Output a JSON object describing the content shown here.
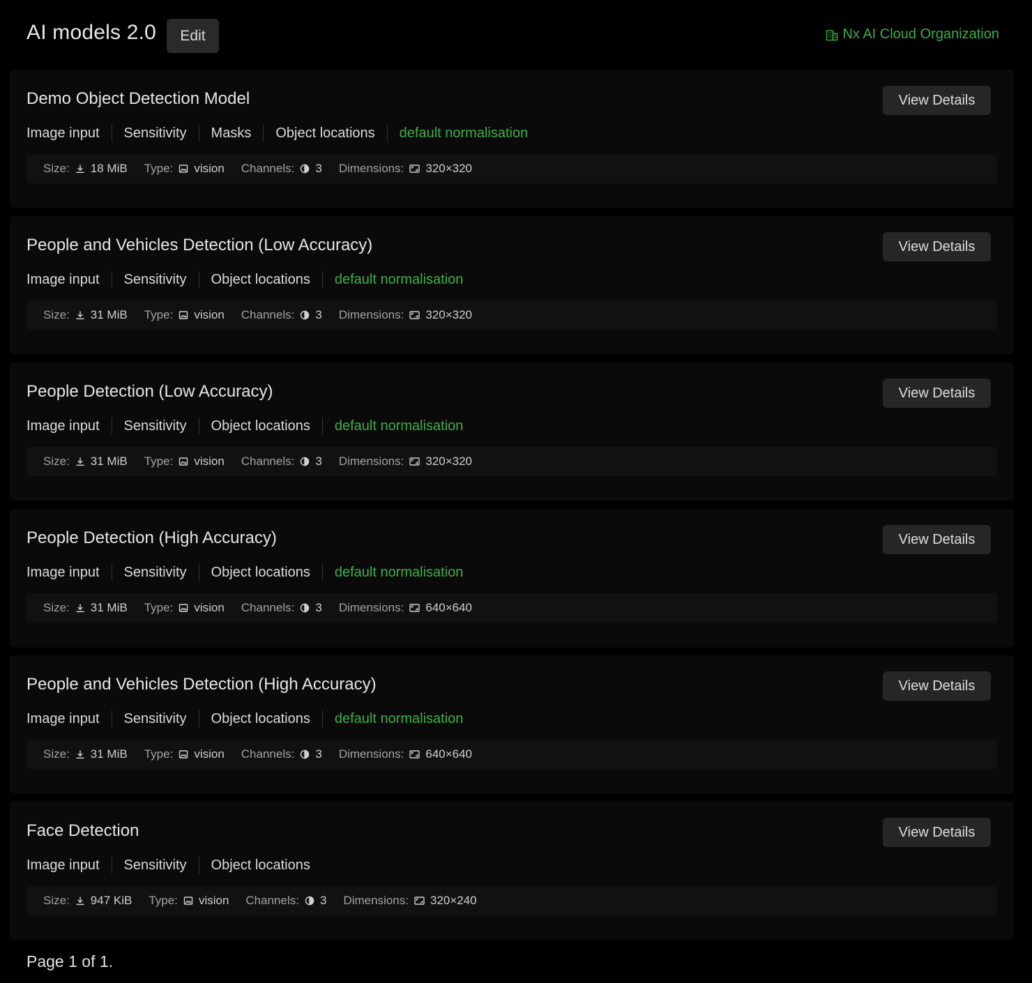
{
  "header": {
    "title": "AI models 2.0",
    "edit_label": "Edit",
    "organization": "Nx AI Cloud Organization"
  },
  "labels": {
    "size": "Size:",
    "type": "Type:",
    "channels": "Channels:",
    "dimensions": "Dimensions:",
    "view_details": "View Details"
  },
  "models": [
    {
      "name": "Demo Object Detection Model",
      "tags": [
        "Image input",
        "Sensitivity",
        "Masks",
        "Object locations"
      ],
      "normalisation": "default normalisation",
      "size": "18 MiB",
      "type": "vision",
      "channels": "3",
      "dimensions": "320×320"
    },
    {
      "name": "People and Vehicles Detection (Low Accuracy)",
      "tags": [
        "Image input",
        "Sensitivity",
        "Object locations"
      ],
      "normalisation": "default normalisation",
      "size": "31 MiB",
      "type": "vision",
      "channels": "3",
      "dimensions": "320×320"
    },
    {
      "name": "People Detection (Low Accuracy)",
      "tags": [
        "Image input",
        "Sensitivity",
        "Object locations"
      ],
      "normalisation": "default normalisation",
      "size": "31 MiB",
      "type": "vision",
      "channels": "3",
      "dimensions": "320×320"
    },
    {
      "name": "People Detection (High Accuracy)",
      "tags": [
        "Image input",
        "Sensitivity",
        "Object locations"
      ],
      "normalisation": "default normalisation",
      "size": "31 MiB",
      "type": "vision",
      "channels": "3",
      "dimensions": "640×640"
    },
    {
      "name": "People and Vehicles Detection (High Accuracy)",
      "tags": [
        "Image input",
        "Sensitivity",
        "Object locations"
      ],
      "normalisation": "default normalisation",
      "size": "31 MiB",
      "type": "vision",
      "channels": "3",
      "dimensions": "640×640"
    },
    {
      "name": "Face Detection",
      "tags": [
        "Image input",
        "Sensitivity",
        "Object locations"
      ],
      "normalisation": "",
      "size": "947 KiB",
      "type": "vision",
      "channels": "3",
      "dimensions": "320×240"
    }
  ],
  "pagination": {
    "text": "Page 1 of 1."
  },
  "icons": {
    "organization": "building-icon",
    "size": "download-icon",
    "type": "image-icon",
    "channels": "channels-icon",
    "dimensions": "aspect-ratio-icon"
  },
  "colors": {
    "background": "#000000",
    "card": "#0a0a0a",
    "meta_bar": "#111111",
    "button": "#262626",
    "accent_green": "#3fae49"
  }
}
